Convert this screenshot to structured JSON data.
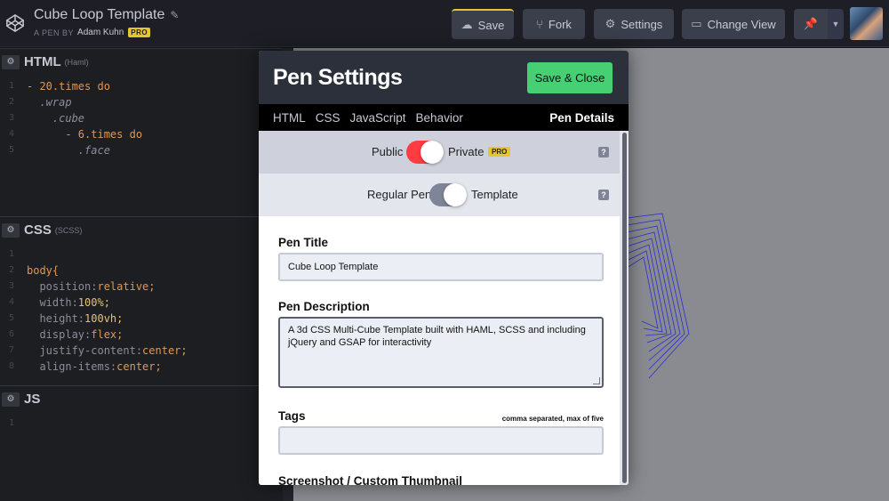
{
  "header": {
    "pen_title": "Cube Loop Template",
    "byline_prefix": "A PEN BY",
    "author": "Adam Kuhn",
    "pro_badge": "PRO",
    "buttons": {
      "save": "Save",
      "fork": "Fork",
      "settings": "Settings",
      "change_view": "Change View"
    },
    "colors": {
      "accent": "#e4c62e",
      "bar": "#1e1f26"
    }
  },
  "panels": {
    "html": {
      "name": "HTML",
      "sub": "(Haml)",
      "lines": [
        {
          "n": "1",
          "code": "- 20.times do"
        },
        {
          "n": "2",
          "code": "  .wrap"
        },
        {
          "n": "3",
          "code": "    .cube"
        },
        {
          "n": "4",
          "code": "      - 6.times do"
        },
        {
          "n": "5",
          "code": "        .face"
        }
      ]
    },
    "css": {
      "name": "CSS",
      "sub": "(SCSS)",
      "lines": [
        {
          "n": "1",
          "code": ""
        },
        {
          "n": "2",
          "code": "body{"
        },
        {
          "n": "3",
          "prop": "  position:",
          "val": "relative;"
        },
        {
          "n": "4",
          "prop": "  width:",
          "val": "100%;"
        },
        {
          "n": "5",
          "prop": "  height:",
          "val": "100vh;"
        },
        {
          "n": "6",
          "prop": "  display:",
          "val": "flex;"
        },
        {
          "n": "7",
          "prop": "  justify-content:",
          "val": "center;"
        },
        {
          "n": "8",
          "prop": "  align-items:",
          "val": "center;"
        }
      ]
    },
    "js": {
      "name": "JS",
      "lines": [
        {
          "n": "1",
          "code": ""
        }
      ]
    }
  },
  "modal": {
    "title": "Pen Settings",
    "save_close": "Save & Close",
    "tabs": [
      "HTML",
      "CSS",
      "JavaScript",
      "Behavior"
    ],
    "active_tab": "Pen Details",
    "privacy": {
      "left": "Public",
      "right": "Private",
      "badge": "PRO",
      "help": "?",
      "on": true
    },
    "template": {
      "left": "Regular Pen",
      "right": "Template",
      "help": "?",
      "on": true
    },
    "pen_title_label": "Pen Title",
    "pen_title_value": "Cube Loop Template",
    "pen_desc_label": "Pen Description",
    "pen_desc_value": "A 3d CSS Multi-Cube Template built with HAML, SCSS and including jQuery and GSAP for interactivity",
    "tags_label": "Tags",
    "tags_hint": "comma separated, max of five",
    "tags_value": "",
    "screenshot_label": "Screenshot / Custom Thumbnail",
    "colors": {
      "save_green": "#47cf73",
      "toggle_red": "#ff3c41",
      "toggle_gray": "#7f8598"
    }
  }
}
